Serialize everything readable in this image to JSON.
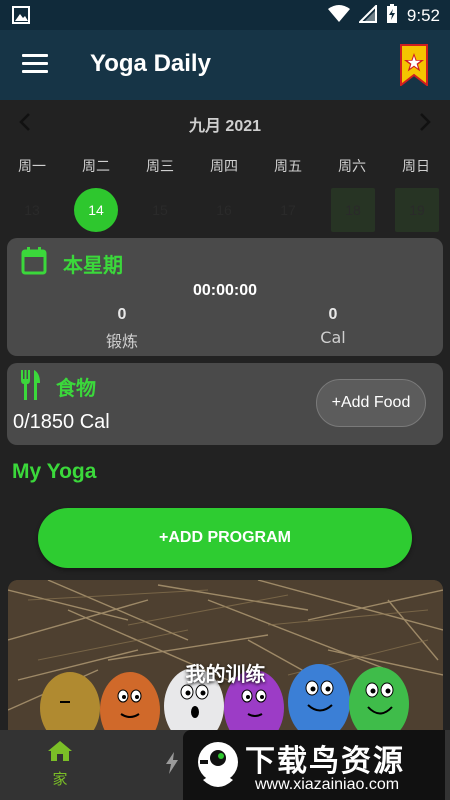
{
  "status_bar": {
    "time": "9:52",
    "icons": [
      "image-icon",
      "wifi-icon",
      "signal-icon",
      "battery-charging-icon"
    ]
  },
  "app_bar": {
    "title": "Yoga Daily",
    "menu_icon": "hamburger-menu-icon",
    "action_icon": "bookmark-star-icon"
  },
  "calendar": {
    "month_label": "九月 2021",
    "weekdays": [
      "周一",
      "周二",
      "周三",
      "周四",
      "周五",
      "周六",
      "周日"
    ],
    "dates": [
      "13",
      "14",
      "15",
      "16",
      "17",
      "18",
      "19"
    ],
    "selected_date": "14"
  },
  "this_week": {
    "title": "本星期",
    "timer": "00:00:00",
    "workouts_value": "0",
    "workouts_label": "锻炼",
    "cal_value": "0",
    "cal_label": "Cal"
  },
  "food": {
    "title": "食物",
    "calories": "0/1850 Cal",
    "add_button": "+Add Food"
  },
  "my_yoga": {
    "heading": "My Yoga",
    "add_program_button": "+ADD PROGRAM",
    "program_card_title": "我的训练"
  },
  "bottom_nav": {
    "home_label": "家"
  },
  "watermark": {
    "brand": "下载鸟资源",
    "url": "www.xiazainiao.com"
  },
  "colors": {
    "accent_green": "#3bd83b",
    "app_bar": "#163446",
    "card_bg": "#4a4a4a"
  }
}
